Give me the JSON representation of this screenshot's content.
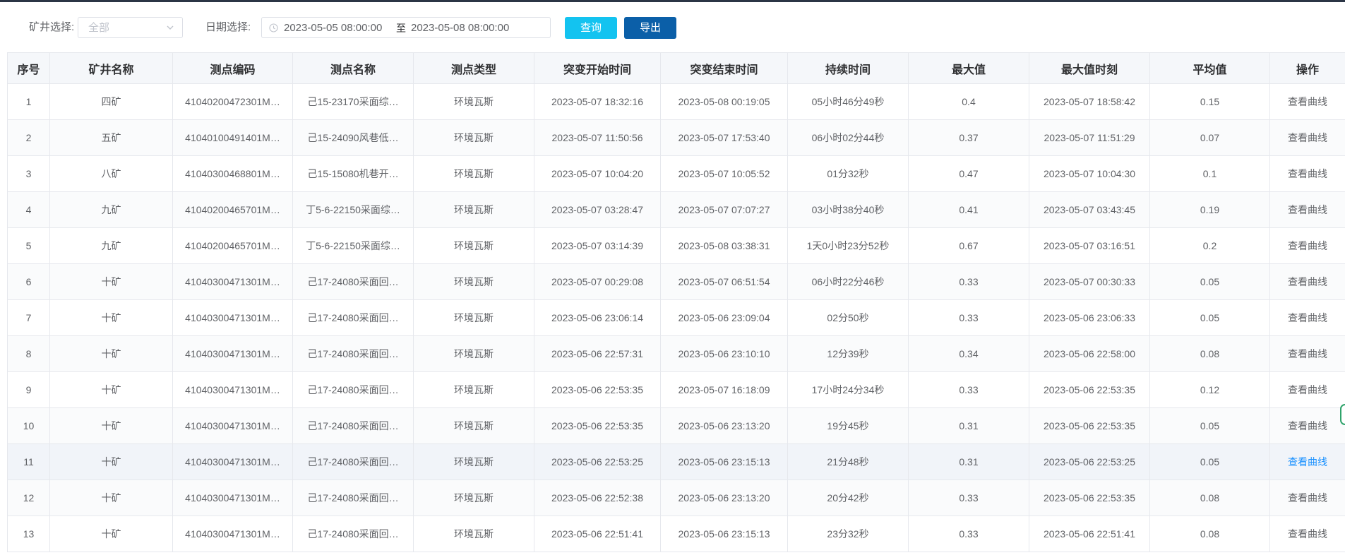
{
  "toolbar": {
    "mine_label": "矿井选择:",
    "mine_placeholder": "全部",
    "date_label": "日期选择:",
    "date_start": "2023-05-05 08:00:00",
    "date_separator": "至",
    "date_end": "2023-05-08 08:00:00",
    "query_label": "查询",
    "export_label": "导出",
    "query_color": "#13c3f0",
    "export_color": "#0b5fa8"
  },
  "table": {
    "columns": [
      "序号",
      "矿井名称",
      "测点编码",
      "测点名称",
      "测点类型",
      "突变开始时间",
      "突变结束时间",
      "持续时间",
      "最大值",
      "最大值时刻",
      "平均值",
      "操作"
    ],
    "rows": [
      {
        "idx": "1",
        "mine": "四矿",
        "code": "41040200472301M…",
        "name": "己15-23170采面综…",
        "type": "环境瓦斯",
        "start": "2023-05-07 18:32:16",
        "end": "2023-05-08 00:19:05",
        "duration": "05小时46分49秒",
        "max": "0.4",
        "max_time": "2023-05-07 18:58:42",
        "avg": "0.15",
        "action": "查看曲线"
      },
      {
        "idx": "2",
        "mine": "五矿",
        "code": "41040100491401M…",
        "name": "己15-24090风巷低…",
        "type": "环境瓦斯",
        "start": "2023-05-07 11:50:56",
        "end": "2023-05-07 17:53:40",
        "duration": "06小时02分44秒",
        "max": "0.37",
        "max_time": "2023-05-07 11:51:29",
        "avg": "0.07",
        "action": "查看曲线"
      },
      {
        "idx": "3",
        "mine": "八矿",
        "code": "41040300468801M…",
        "name": "己15-15080机巷开…",
        "type": "环境瓦斯",
        "start": "2023-05-07 10:04:20",
        "end": "2023-05-07 10:05:52",
        "duration": "01分32秒",
        "max": "0.47",
        "max_time": "2023-05-07 10:04:30",
        "avg": "0.1",
        "action": "查看曲线"
      },
      {
        "idx": "4",
        "mine": "九矿",
        "code": "41040200465701M…",
        "name": "丁5-6-22150采面综…",
        "type": "环境瓦斯",
        "start": "2023-05-07 03:28:47",
        "end": "2023-05-07 07:07:27",
        "duration": "03小时38分40秒",
        "max": "0.41",
        "max_time": "2023-05-07 03:43:45",
        "avg": "0.19",
        "action": "查看曲线"
      },
      {
        "idx": "5",
        "mine": "九矿",
        "code": "41040200465701M…",
        "name": "丁5-6-22150采面综…",
        "type": "环境瓦斯",
        "start": "2023-05-07 03:14:39",
        "end": "2023-05-08 03:38:31",
        "duration": "1天0小时23分52秒",
        "max": "0.67",
        "max_time": "2023-05-07 03:16:51",
        "avg": "0.2",
        "action": "查看曲线"
      },
      {
        "idx": "6",
        "mine": "十矿",
        "code": "41040300471301M…",
        "name": "己17-24080采面回…",
        "type": "环境瓦斯",
        "start": "2023-05-07 00:29:08",
        "end": "2023-05-07 06:51:54",
        "duration": "06小时22分46秒",
        "max": "0.33",
        "max_time": "2023-05-07 00:30:33",
        "avg": "0.05",
        "action": "查看曲线"
      },
      {
        "idx": "7",
        "mine": "十矿",
        "code": "41040300471301M…",
        "name": "己17-24080采面回…",
        "type": "环境瓦斯",
        "start": "2023-05-06 23:06:14",
        "end": "2023-05-06 23:09:04",
        "duration": "02分50秒",
        "max": "0.33",
        "max_time": "2023-05-06 23:06:33",
        "avg": "0.05",
        "action": "查看曲线"
      },
      {
        "idx": "8",
        "mine": "十矿",
        "code": "41040300471301M…",
        "name": "己17-24080采面回…",
        "type": "环境瓦斯",
        "start": "2023-05-06 22:57:31",
        "end": "2023-05-06 23:10:10",
        "duration": "12分39秒",
        "max": "0.34",
        "max_time": "2023-05-06 22:58:00",
        "avg": "0.08",
        "action": "查看曲线"
      },
      {
        "idx": "9",
        "mine": "十矿",
        "code": "41040300471301M…",
        "name": "己17-24080采面回…",
        "type": "环境瓦斯",
        "start": "2023-05-06 22:53:35",
        "end": "2023-05-07 16:18:09",
        "duration": "17小时24分34秒",
        "max": "0.33",
        "max_time": "2023-05-06 22:53:35",
        "avg": "0.12",
        "action": "查看曲线"
      },
      {
        "idx": "10",
        "mine": "十矿",
        "code": "41040300471301M…",
        "name": "己17-24080采面回…",
        "type": "环境瓦斯",
        "start": "2023-05-06 22:53:35",
        "end": "2023-05-06 23:13:20",
        "duration": "19分45秒",
        "max": "0.31",
        "max_time": "2023-05-06 22:53:35",
        "avg": "0.05",
        "action": "查看曲线"
      },
      {
        "idx": "11",
        "mine": "十矿",
        "code": "41040300471301M…",
        "name": "己17-24080采面回…",
        "type": "环境瓦斯",
        "start": "2023-05-06 22:53:25",
        "end": "2023-05-06 23:15:13",
        "duration": "21分48秒",
        "max": "0.31",
        "max_time": "2023-05-06 22:53:25",
        "avg": "0.05",
        "action": "查看曲线",
        "hover": true
      },
      {
        "idx": "12",
        "mine": "十矿",
        "code": "41040300471301M…",
        "name": "己17-24080采面回…",
        "type": "环境瓦斯",
        "start": "2023-05-06 22:52:38",
        "end": "2023-05-06 23:13:20",
        "duration": "20分42秒",
        "max": "0.33",
        "max_time": "2023-05-06 22:53:35",
        "avg": "0.08",
        "action": "查看曲线"
      },
      {
        "idx": "13",
        "mine": "十矿",
        "code": "41040300471301M…",
        "name": "己17-24080采面回…",
        "type": "环境瓦斯",
        "start": "2023-05-06 22:51:41",
        "end": "2023-05-06 23:15:13",
        "duration": "23分32秒",
        "max": "0.33",
        "max_time": "2023-05-06 22:51:41",
        "avg": "0.08",
        "action": "查看曲线"
      }
    ],
    "link_hover_color": "#1890ff"
  }
}
